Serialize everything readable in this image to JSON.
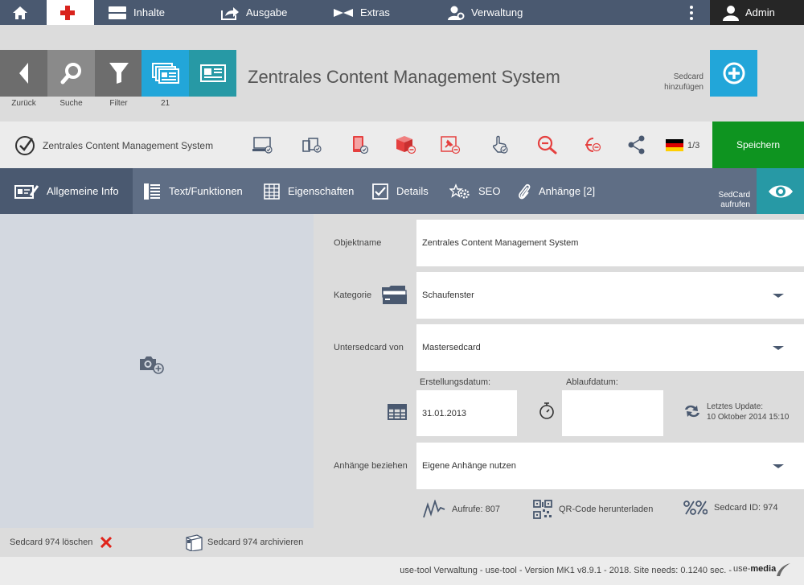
{
  "nav": {
    "items": [
      "Inhalte",
      "Ausgabe",
      "Extras",
      "Verwaltung"
    ],
    "user": "Admin"
  },
  "header": {
    "buttons": [
      "Zurück",
      "Suche",
      "Filter",
      "21"
    ],
    "title": "Zentrales Content Management System",
    "add_label_line1": "Sedcard",
    "add_label_line2": "hinzufügen"
  },
  "toolbar": {
    "crumb": "Zentrales Content Management System",
    "lang_count": "1/3",
    "save": "Speichern"
  },
  "tabs": {
    "items": [
      "Allgemeine Info",
      "Text/Funktionen",
      "Eigenschaften",
      "Details",
      "SEO",
      "Anhänge [2]"
    ],
    "view_line1": "SedCard",
    "view_line2": "aufrufen"
  },
  "form": {
    "objektname_label": "Objektname",
    "objektname_value": "Zentrales Content Management System",
    "kategorie_label": "Kategorie",
    "kategorie_value": "Schaufenster",
    "untersedcard_label": "Untersedcard von",
    "untersedcard_value": "Mastersedcard",
    "erstellung_label": "Erstellungsdatum:",
    "erstellung_value": "31.01.2013",
    "ablauf_label": "Ablaufdatum:",
    "ablauf_value": "",
    "update_label": "Letztes Update:",
    "update_value": "10 Oktober 2014 15:10",
    "anhaenge_label": "Anhänge beziehen",
    "anhaenge_value": "Eigene Anhänge nutzen"
  },
  "stats": {
    "aufrufe": "Aufrufe: 807",
    "qr": "QR-Code herunterladen",
    "id": "Sedcard ID: 974"
  },
  "actions": {
    "delete": "Sedcard 974 löschen",
    "archive": "Sedcard 974 archivieren"
  },
  "footer": {
    "text": "use-tool Verwaltung - use-tool - Version MK1 v8.9.1 - 2018. Site needs: 0.1240 sec. -",
    "brand_prefix": "use-",
    "brand_bold": "media"
  },
  "colors": {
    "nav_bg": "#4a5970",
    "tab_bg": "#5f6e85",
    "accent_blue": "#22a6d9",
    "accent_teal": "#2799a5",
    "save_green": "#0e9420",
    "tool_red": "#e5403f"
  }
}
